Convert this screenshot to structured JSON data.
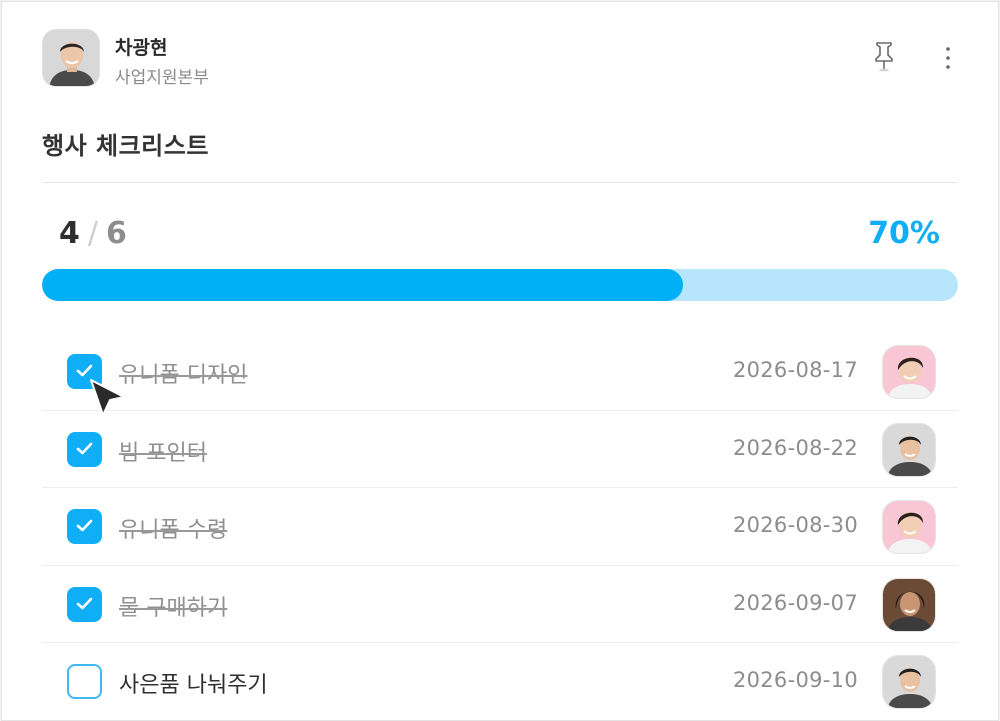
{
  "author": {
    "name": "차광현",
    "department": "사업지원본부"
  },
  "header_icons": {
    "pin": "pin-icon",
    "more": "more-vertical-icon"
  },
  "checklist": {
    "title": "행사 체크리스트",
    "completed": "4",
    "separator": "/",
    "total": "6",
    "percent_label": "70%",
    "progress": 0.7,
    "items": [
      {
        "label": "유니폼 디자인",
        "date": "2026-08-17",
        "checked": true,
        "assignee": "woman-pink"
      },
      {
        "label": "빔 포인터",
        "date": "2026-08-22",
        "checked": true,
        "assignee": "man-gray"
      },
      {
        "label": "유니폼 수령",
        "date": "2026-08-30",
        "checked": true,
        "assignee": "woman-pink"
      },
      {
        "label": "물 구매하기",
        "date": "2026-09-07",
        "checked": true,
        "assignee": "woman-dark"
      },
      {
        "label": "사은품 나눠주기",
        "date": "2026-09-10",
        "checked": false,
        "assignee": "man-gray-2"
      }
    ]
  },
  "colors": {
    "accent": "#00b0f7",
    "track": "#b7e5fb",
    "avatar_pink_bg": "#f8c6d4",
    "avatar_gray_bg": "#d9d9d9",
    "avatar_dark_bg": "#6b4a36"
  }
}
